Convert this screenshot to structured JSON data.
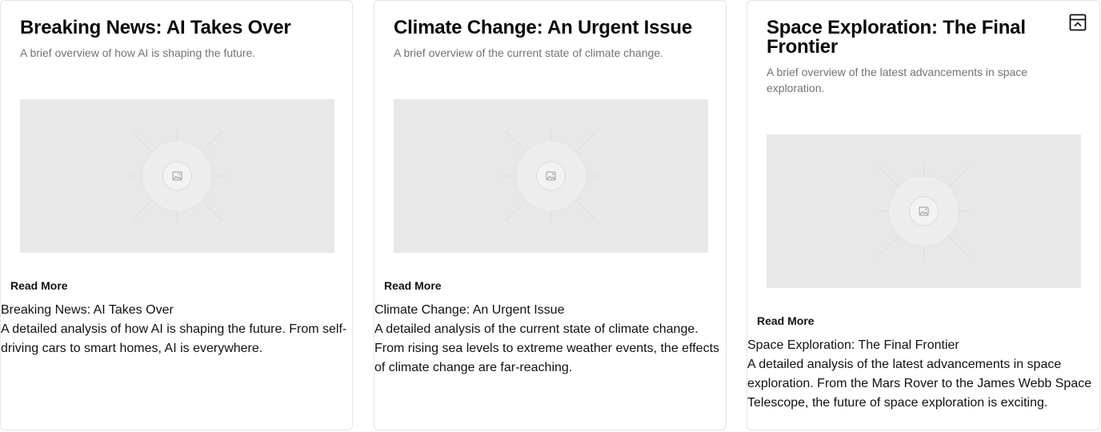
{
  "cards": [
    {
      "title": "Breaking News: AI Takes Over",
      "subtitle": "A brief overview of how AI is shaping the future.",
      "image_icon": "image-icon",
      "button_label": "Read More",
      "body_title": "Breaking News: AI Takes Over",
      "body_text": "A detailed analysis of how AI is shaping the future. From self-driving cars to smart homes, AI is everywhere."
    },
    {
      "title": "Climate Change: An Urgent Issue",
      "subtitle": "A brief overview of the current state of climate change.",
      "image_icon": "image-icon",
      "button_label": "Read More",
      "body_title": "Climate Change: An Urgent Issue",
      "body_text": "A detailed analysis of the current state of climate change. From rising sea levels to extreme weather events, the effects of climate change are far-reaching."
    },
    {
      "title": "Space Exploration: The Final Frontier",
      "subtitle": "A brief overview of the latest advancements in space exploration.",
      "image_icon": "image-icon",
      "button_label": "Read More",
      "body_title": "Space Exploration: The Final Frontier",
      "body_text": "A detailed analysis of the latest advancements in space exploration. From the Mars Rover to the James Webb Space Telescope, the future of space exploration is exciting.",
      "corner_icon": "collapse-panel-icon"
    }
  ],
  "colors": {
    "placeholder_bg": "#e8e8e8",
    "subtitle": "#737373",
    "border": "#e5e5e5"
  }
}
